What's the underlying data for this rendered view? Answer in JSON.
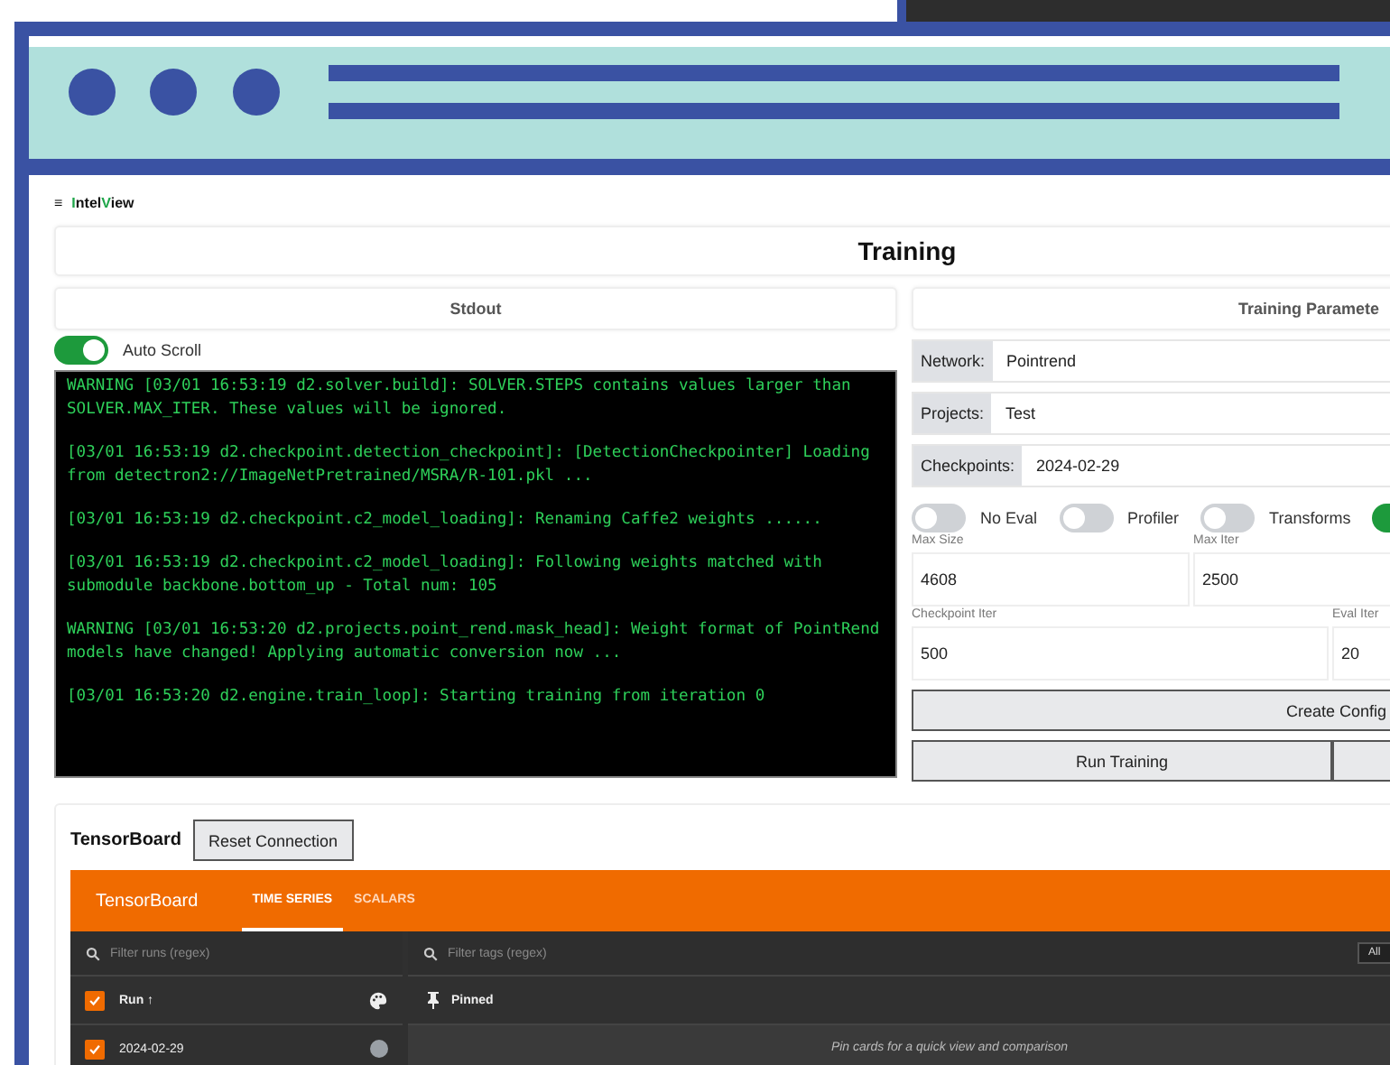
{
  "logo": {
    "menu_glyph": "≡",
    "parts": [
      {
        "text": "I",
        "accent": true
      },
      {
        "text": "ntel",
        "accent": false
      },
      {
        "text": "V",
        "accent": true
      },
      {
        "text": "iew",
        "accent": false
      }
    ]
  },
  "page_title": "Training",
  "stdout": {
    "title": "Stdout",
    "auto_scroll": {
      "label": "Auto Scroll",
      "on": true
    },
    "log": [
      "WARNING [03/01 16:53:19 d2.solver.build]: SOLVER.STEPS contains values larger than SOLVER.MAX_ITER. These values will be ignored.",
      "[03/01 16:53:19 d2.checkpoint.detection_checkpoint]: [DetectionCheckpointer] Loading from detectron2://ImageNetPretrained/MSRA/R-101.pkl ...",
      "[03/01 16:53:19 d2.checkpoint.c2_model_loading]: Renaming Caffe2 weights ......",
      "[03/01 16:53:19 d2.checkpoint.c2_model_loading]: Following weights matched with submodule backbone.bottom_up - Total num: 105",
      "WARNING [03/01 16:53:20 d2.projects.point_rend.mask_head]: Weight format of PointRend models have changed! Applying automatic conversion now ...",
      "[03/01 16:53:20 d2.engine.train_loop]: Starting training from iteration 0"
    ]
  },
  "params": {
    "title": "Training Paramete",
    "selects": [
      {
        "label": "Network:",
        "value": "Pointrend"
      },
      {
        "label": "Projects:",
        "value": "Test"
      },
      {
        "label": "Checkpoints:",
        "value": "2024-02-29"
      }
    ],
    "switches": [
      {
        "label": "No Eval",
        "on": false
      },
      {
        "label": "Profiler",
        "on": false
      },
      {
        "label": "Transforms",
        "on": false
      },
      {
        "on": true
      }
    ],
    "fields": [
      [
        {
          "label": "Max Size",
          "value": "4608"
        },
        {
          "label": "Max Iter",
          "value": "2500"
        }
      ],
      [
        {
          "label": "Checkpoint Iter",
          "value": "500"
        },
        {
          "label": "Eval Iter",
          "value": "20"
        }
      ]
    ],
    "create_button": "Create Config",
    "run_button": "Run Training"
  },
  "tensorboard": {
    "title": "TensorBoard",
    "reset_button": "Reset Connection",
    "brand": "TensorBoard",
    "tabs": [
      {
        "label": "TIME SERIES",
        "selected": true
      },
      {
        "label": "SCALARS",
        "selected": false
      }
    ],
    "runs_filter": {
      "placeholder": "Filter runs (regex)"
    },
    "tags_filter": {
      "placeholder": "Filter tags (regex)"
    },
    "all_button": "All",
    "runs_header": {
      "label": "Run ↑",
      "checked": true
    },
    "runs": [
      {
        "name": "2024-02-29",
        "checked": true,
        "color": "#9aa0a6"
      }
    ],
    "pinned": "Pinned",
    "pinned_hint": "Pin cards for a quick view and comparison"
  }
}
